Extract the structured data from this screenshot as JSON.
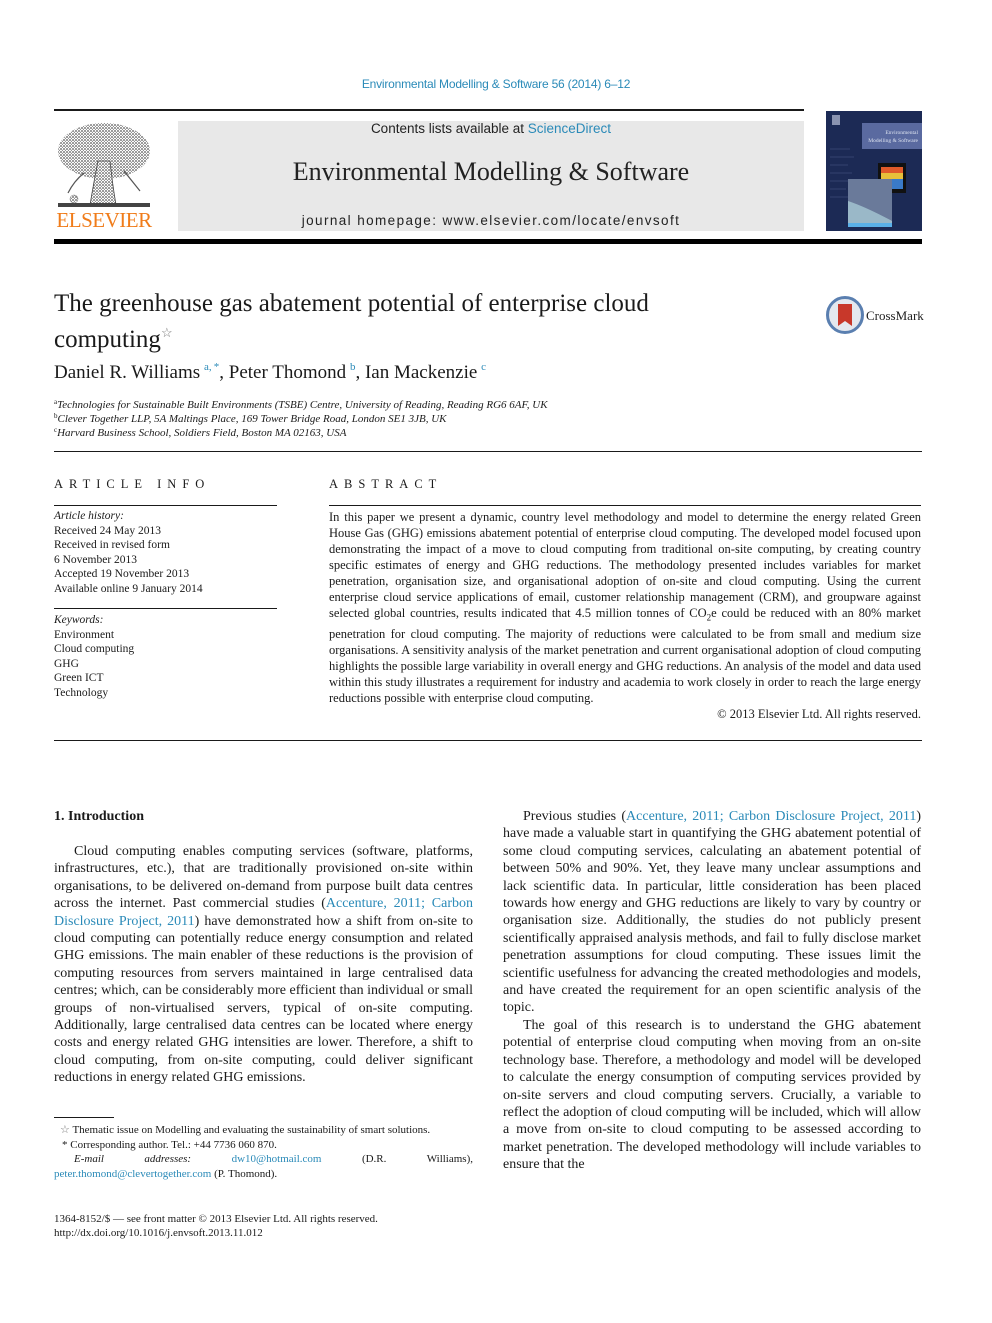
{
  "header": {
    "citation": "Environmental Modelling & Software 56 (2014) 6–12",
    "contents_prefix": "Contents lists available at ",
    "contents_link": "ScienceDirect",
    "journal_name": "Environmental Modelling & Software",
    "homepage": "journal homepage: www.elsevier.com/locate/envsoft",
    "publisher_logo": "ELSEVIER",
    "cover_title_line1": "Environmental",
    "cover_title_line2": "Modelling & Software",
    "brand_color": "#f07c1a",
    "link_color": "#2a8ab8"
  },
  "article": {
    "title_line1": "The greenhouse gas abatement potential of enterprise cloud",
    "title_line2": "computing",
    "title_mark": "☆",
    "crossmark_label": "CrossMark",
    "authors": [
      {
        "name": "Daniel R. Williams",
        "sup": "a, *",
        "sep": ", "
      },
      {
        "name": "Peter Thomond",
        "sup": "b",
        "sep": ", "
      },
      {
        "name": "Ian Mackenzie",
        "sup": "c",
        "sep": ""
      }
    ],
    "affiliations": [
      {
        "mark": "a",
        "text": "Technologies for Sustainable Built Environments (TSBE) Centre, University of Reading, Reading RG6 6AF, UK"
      },
      {
        "mark": "b",
        "text": "Clever Together LLP, 5A Maltings Place, 169 Tower Bridge Road, London SE1 3JB, UK"
      },
      {
        "mark": "c",
        "text": "Harvard Business School, Soldiers Field, Boston MA 02163, USA"
      }
    ]
  },
  "article_info": {
    "heading": "ARTICLE INFO",
    "history_label": "Article history:",
    "history": [
      "Received 24 May 2013",
      "Received in revised form",
      "6 November 2013",
      "Accepted 19 November 2013",
      "Available online 9 January 2014"
    ],
    "keywords_label": "Keywords:",
    "keywords": [
      "Environment",
      "Cloud computing",
      "GHG",
      "Green ICT",
      "Technology"
    ]
  },
  "abstract": {
    "heading": "ABSTRACT",
    "text_part1": "In this paper we present a dynamic, country level methodology and model to determine the energy related Green House Gas (GHG) emissions abatement potential of enterprise cloud computing. The developed model focused upon demonstrating the impact of a move to cloud computing from traditional on-site computing, by creating country specific estimates of energy and GHG reductions. The methodology presented includes variables for market penetration, organisation size, and organisational adoption of on-site and cloud computing. Using the current enterprise cloud service applications of email, customer relationship management (CRM), and groupware against selected global countries, results indicated that 4.5 million tonnes of CO",
    "text_sub": "2",
    "text_part2": "e could be reduced with an 80% market penetration for cloud computing. The majority of reductions were calculated to be from small and medium size organisations. A sensitivity analysis of the market penetration and current organisational adoption of cloud computing highlights the possible large variability in overall energy and GHG reductions. An analysis of the model and data used within this study illustrates a requirement for industry and academia to work closely in order to reach the large energy reductions possible with enterprise cloud computing.",
    "copyright": "© 2013 Elsevier Ltd. All rights reserved."
  },
  "intro": {
    "heading": "1.  Introduction",
    "p1_before": "Cloud computing enables computing services (software, platforms, infrastructures, etc.), that are traditionally provisioned on-site within organisations, to be delivered on-demand from purpose built data centres across the internet. Past commercial studies (",
    "p1_cite": "Accenture, 2011; Carbon Disclosure Project, 2011",
    "p1_after": ") have demonstrated how a shift from on-site to cloud computing can potentially reduce energy consumption and related GHG emissions. The main enabler of these reductions is the provision of computing resources from servers maintained in large centralised data centres; which, can be considerably more efficient than individual or small groups of non-virtualised servers, typical of on-site computing. Additionally, large centralised data centres can be located where energy costs and energy related GHG intensities are lower. Therefore, a shift to cloud computing, from on-site computing, could deliver significant reductions in energy related GHG emissions.",
    "p2_before": "Previous studies (",
    "p2_cite": "Accenture, 2011; Carbon Disclosure Project, 2011",
    "p2_after": ") have made a valuable start in quantifying the GHG abatement potential of some cloud computing services, calculating an abatement potential of between 50% and 90%. Yet, they leave many unclear assumptions and lack scientific data. In particular, little consideration has been placed towards how energy and GHG reductions are likely to vary by country or organisation size. Additionally, the studies do not publicly present scientifically appraised analysis methods, and fail to fully disclose market penetration assumptions for cloud computing. These issues limit the scientific usefulness for advancing the created methodologies and models, and have created the requirement for an open scientific analysis of the topic.",
    "p3": "The goal of this research is to understand the GHG abatement potential of enterprise cloud computing when moving from an on-site technology base. Therefore, a methodology and model will be developed to calculate the energy consumption of computing services provided by on-site servers and cloud computing servers. Crucially, a variable to reflect the adoption of cloud computing will be included, which will allow a move from on-site to cloud computing to be assessed according to market penetration. The developed methodology will include variables to ensure that the"
  },
  "footnotes": {
    "star_mark": "☆",
    "star_text": "Thematic issue on Modelling and evaluating the sustainability of smart solutions.",
    "corr_mark": "*",
    "corr_text": "Corresponding author. Tel.: +44 7736 060 870.",
    "email_label": "E-mail addresses:",
    "email1": "dw10@hotmail.com",
    "email1_owner": " (D.R. Williams), ",
    "email2": "peter.thomond@clevertogether.com",
    "email2_owner": " (P. Thomond).",
    "issn": "1364-8152/$ — see front matter © 2013 Elsevier Ltd. All rights reserved.",
    "doi": "http://dx.doi.org/10.1016/j.envsoft.2013.11.012"
  }
}
